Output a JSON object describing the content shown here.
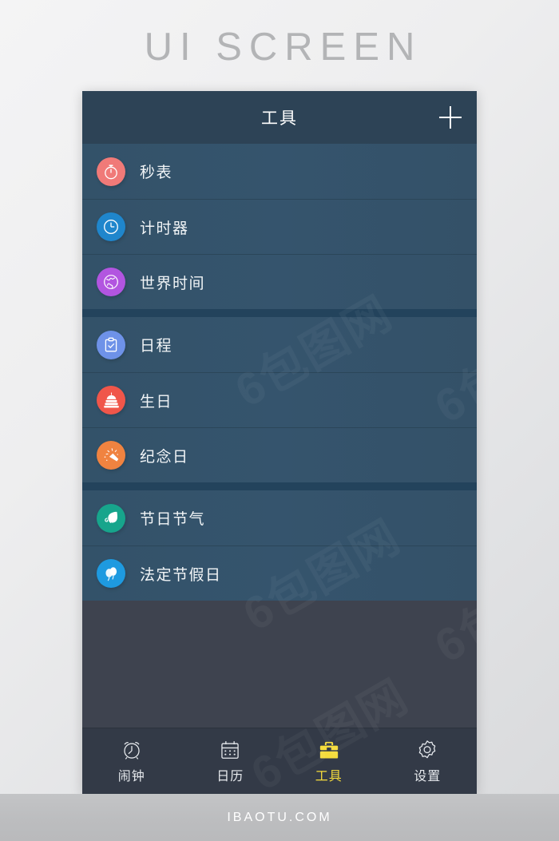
{
  "page": {
    "heading": "UI SCREEN",
    "footer_text": "IBAOTU.COM",
    "watermark_text": "6包图网"
  },
  "colors": {
    "header_bg": "#2d4356",
    "row_bg": "#34536e",
    "group_gap": "#23435c",
    "empty_bg": "#3e434f",
    "tabbar_bg": "#333a47",
    "accent_active": "#f5dc3c",
    "text_primary": "#f2f5f7"
  },
  "appbar": {
    "title": "工具",
    "add_label": "+"
  },
  "list": {
    "groups": [
      {
        "rows": [
          {
            "label": "秒表",
            "icon": "stopwatch-icon",
            "color": "#f07a78"
          },
          {
            "label": "计时器",
            "icon": "clock-icon",
            "color": "#1f86cc"
          },
          {
            "label": "世界时间",
            "icon": "globe-icon",
            "color": "#b255e0"
          }
        ]
      },
      {
        "rows": [
          {
            "label": "日程",
            "icon": "clipboard-check-icon",
            "color": "#6e92e8"
          },
          {
            "label": "生日",
            "icon": "birthday-cake-icon",
            "color": "#f0564a"
          },
          {
            "label": "纪念日",
            "icon": "party-popper-icon",
            "color": "#f08340"
          }
        ]
      },
      {
        "rows": [
          {
            "label": "节日节气",
            "icon": "leaf-icon",
            "color": "#17a58c"
          },
          {
            "label": "法定节假日",
            "icon": "balloons-icon",
            "color": "#1e9ae0"
          }
        ]
      }
    ]
  },
  "tabbar": {
    "tabs": [
      {
        "label": "闹钟",
        "icon": "alarm-clock-icon",
        "active": false
      },
      {
        "label": "日历",
        "icon": "calendar-icon",
        "active": false
      },
      {
        "label": "工具",
        "icon": "toolbox-icon",
        "active": true
      },
      {
        "label": "设置",
        "icon": "gear-icon",
        "active": false
      }
    ]
  }
}
